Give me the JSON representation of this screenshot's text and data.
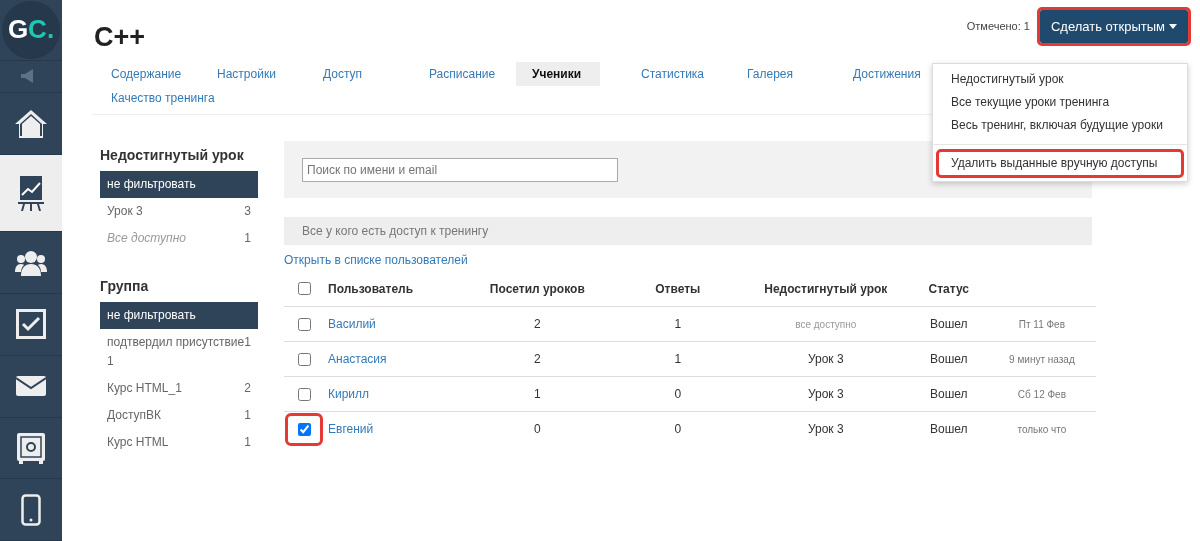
{
  "nav": [
    {
      "kind": "logo",
      "selected": false
    },
    {
      "kind": "speaker",
      "selected": false
    },
    {
      "kind": "home",
      "selected": false
    },
    {
      "kind": "chart",
      "selected": true
    },
    {
      "kind": "users",
      "selected": false
    },
    {
      "kind": "check",
      "selected": false
    },
    {
      "kind": "mail",
      "selected": false
    },
    {
      "kind": "safe",
      "selected": false
    },
    {
      "kind": "phone",
      "selected": false
    }
  ],
  "logo": {
    "letter_1": "G",
    "letter_2": "C."
  },
  "title": "C++",
  "marked": "Отмечено: 1",
  "action_button": {
    "label": "Сделать открытым",
    "highlighted": true
  },
  "dropdown": [
    {
      "label": "Недостигнутый урок",
      "highlighted": false,
      "divider_before": false
    },
    {
      "label": "Все текущие уроки тренинга",
      "highlighted": false,
      "divider_before": false
    },
    {
      "label": "Весь тренинг, включая будущие уроки",
      "highlighted": false,
      "divider_before": false
    },
    {
      "label": "Удалить выданные вручную доступы",
      "highlighted": true,
      "divider_before": true
    }
  ],
  "tabs": [
    {
      "label": "Содержание",
      "selected": false
    },
    {
      "label": "Настройки",
      "selected": false
    },
    {
      "label": "Доступ",
      "selected": false
    },
    {
      "label": "Расписание",
      "selected": false
    },
    {
      "label": "Ученики",
      "selected": true
    },
    {
      "label": "Статистика",
      "selected": false
    },
    {
      "label": "Галерея",
      "selected": false
    },
    {
      "label": "Достижения",
      "selected": false
    },
    {
      "label": "Качество тренинга",
      "selected": false
    }
  ],
  "filters": [
    {
      "title": "Недостигнутый урок",
      "items": [
        {
          "label": "не фильтровать",
          "selected": true,
          "italic": false
        },
        {
          "label": "Урок 3",
          "count": "3",
          "selected": false,
          "italic": false
        },
        {
          "label": "Все доступно",
          "count": "1",
          "selected": false,
          "italic": true
        }
      ]
    },
    {
      "title": "Группа",
      "items": [
        {
          "label": "не фильтровать",
          "selected": true,
          "italic": false
        },
        {
          "label": "подтвердил присутствие 1",
          "count": "1",
          "selected": false,
          "italic": false
        },
        {
          "label": "Курс HTML_1",
          "count": "2",
          "selected": false,
          "italic": false
        },
        {
          "label": "ДоступВК",
          "count": "1",
          "selected": false,
          "italic": false
        },
        {
          "label": "Курс HTML",
          "count": "1",
          "selected": false,
          "italic": false
        }
      ]
    }
  ],
  "search": {
    "placeholder": "Поиск по имени и email"
  },
  "banner": "Все у кого есть доступ к тренингу",
  "open_link": "Открыть в списке пользователей",
  "table": {
    "header_checked": false,
    "columns": [
      "Пользователь",
      "Посетил уроков",
      "Ответы",
      "Недостигнутый урок",
      "Статус"
    ],
    "rows": [
      {
        "checked": false,
        "highlighted": false,
        "user": "Василий",
        "visits": "2",
        "answers": "1",
        "lesson": "все доступно",
        "lesson_muted": true,
        "status": "Вошел",
        "time": "Пт 11 Фев"
      },
      {
        "checked": false,
        "highlighted": false,
        "user": "Анастасия",
        "visits": "2",
        "answers": "1",
        "lesson": "Урок 3",
        "lesson_muted": false,
        "status": "Вошел",
        "time": "9 минут назад"
      },
      {
        "checked": false,
        "highlighted": false,
        "user": "Кирилл",
        "visits": "1",
        "answers": "0",
        "lesson": "Урок 3",
        "lesson_muted": false,
        "status": "Вошел",
        "time": "Сб 12 Фев"
      },
      {
        "checked": true,
        "highlighted": true,
        "user": "Евгений",
        "visits": "0",
        "answers": "0",
        "lesson": "Урок 3",
        "lesson_muted": false,
        "status": "Вошел",
        "time": "только что"
      }
    ]
  }
}
